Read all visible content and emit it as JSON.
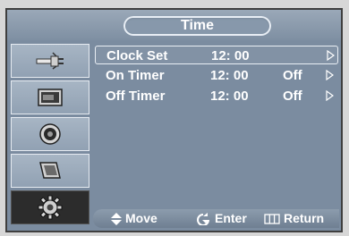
{
  "menu": {
    "title": "Time",
    "sidebar": {
      "items": [
        {
          "icon": "antenna-plug-icon",
          "active": false
        },
        {
          "icon": "picture-icon",
          "active": false
        },
        {
          "icon": "speaker-icon",
          "active": false
        },
        {
          "icon": "channel-icon",
          "active": false
        },
        {
          "icon": "setup-gear-icon",
          "active": true
        }
      ]
    },
    "rows": [
      {
        "label": "Clock Set",
        "value": "12: 00",
        "status": "",
        "selected": true
      },
      {
        "label": "On Timer",
        "value": "12: 00",
        "status": "Off",
        "selected": false
      },
      {
        "label": "Off Timer",
        "value": "12: 00",
        "status": "Off",
        "selected": false
      }
    ],
    "footer": {
      "move": "Move",
      "enter": "Enter",
      "return": "Return"
    }
  }
}
